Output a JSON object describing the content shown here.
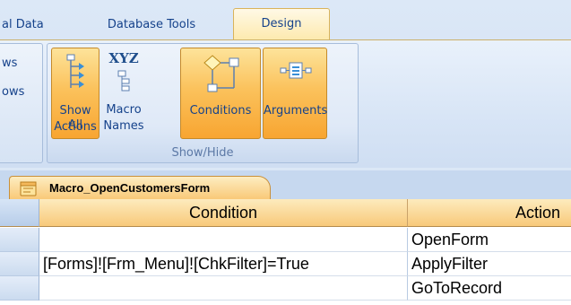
{
  "ribbon": {
    "tabs": [
      {
        "label": "al Data"
      },
      {
        "label": "Database Tools"
      },
      {
        "label": "Design"
      }
    ],
    "left_items": [
      "ws",
      "ows"
    ],
    "group": {
      "label": "Show/Hide",
      "buttons": [
        {
          "label_line1": "Show All",
          "label_line2": "Actions",
          "icon": "show-all-actions-icon",
          "active": true
        },
        {
          "label_line1": "Macro",
          "label_line2": "Names",
          "icon": "macro-names-icon",
          "active": false,
          "icon_text": "XYZ"
        },
        {
          "label_line1": "Conditions",
          "icon": "conditions-icon",
          "active": true
        },
        {
          "label_line1": "Arguments",
          "icon": "arguments-icon",
          "active": true
        }
      ]
    }
  },
  "document": {
    "tab_label": "Macro_OpenCustomersForm",
    "columns": [
      "Condition",
      "Action"
    ],
    "rows": [
      {
        "condition": "",
        "action": "OpenForm"
      },
      {
        "condition": "[Forms]![Frm_Menu]![ChkFilter]=True",
        "action": "ApplyFilter"
      },
      {
        "condition": "",
        "action": "GoToRecord"
      }
    ]
  },
  "colors": {
    "active_button": "#f8a531",
    "ribbon_text": "#15428b",
    "header_fill": "#f8c97a"
  }
}
